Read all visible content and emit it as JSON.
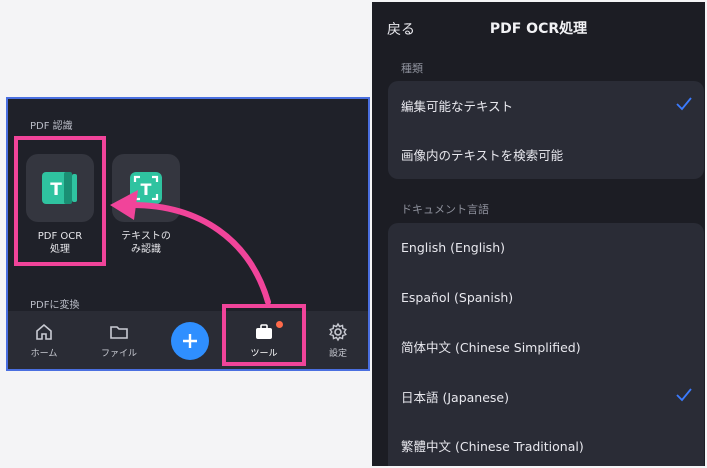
{
  "left": {
    "section_pdf_recognition": "PDF 認識",
    "section_pdf_convert": "PDFに変換",
    "tools": [
      {
        "label": "PDF OCR\n処理",
        "icon": "text-recognition-icon"
      },
      {
        "label": "テキストの\nみ認識",
        "icon": "text-scan-icon"
      }
    ],
    "tabbar": [
      {
        "label": "ホーム",
        "icon": "home-icon"
      },
      {
        "label": "ファイル",
        "icon": "folder-icon"
      },
      {
        "label": "",
        "icon": "plus-icon"
      },
      {
        "label": "ツール",
        "icon": "toolbox-icon"
      },
      {
        "label": "設定",
        "icon": "gear-icon"
      }
    ]
  },
  "right": {
    "back_label": "戻る",
    "title": "PDF OCR処理",
    "type_group_label": "種類",
    "type_options": [
      {
        "label": "編集可能なテキスト",
        "selected": true
      },
      {
        "label": "画像内のテキストを検索可能",
        "selected": false
      }
    ],
    "language_group_label": "ドキュメント言語",
    "language_options": [
      {
        "label": "English (English)",
        "selected": false
      },
      {
        "label": "Español (Spanish)",
        "selected": false
      },
      {
        "label": "简体中文 (Chinese Simplified)",
        "selected": false
      },
      {
        "label": "日本語 (Japanese)",
        "selected": true
      },
      {
        "label": "繁體中文 (Chinese Traditional)",
        "selected": false
      }
    ]
  },
  "colors": {
    "highlight": "#f1449a",
    "accent": "#2f8fff",
    "check": "#3b7bff",
    "panel_border": "#4a6fe0"
  }
}
